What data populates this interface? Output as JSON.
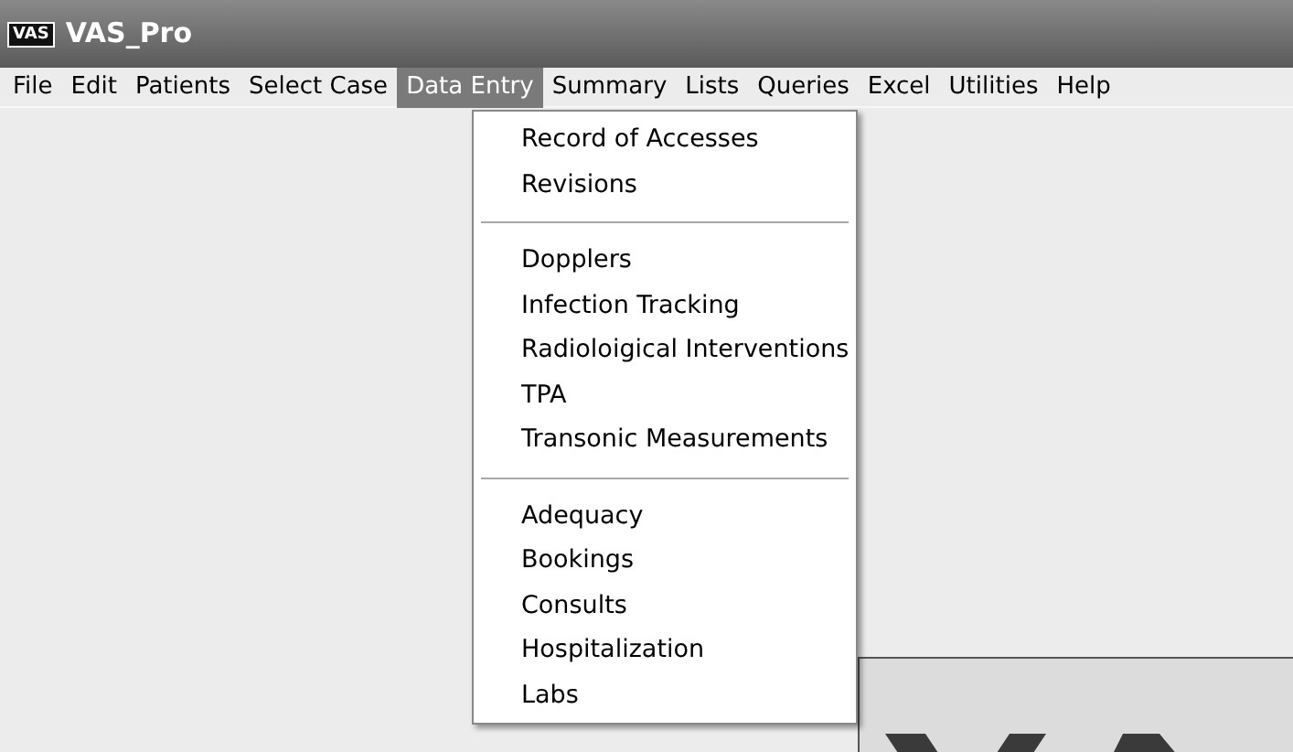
{
  "window": {
    "title": "VAS_Pro",
    "icon_text": "VAS"
  },
  "menu_bar": [
    {
      "label": "File",
      "selected": false
    },
    {
      "label": "Edit",
      "selected": false
    },
    {
      "label": "Patients",
      "selected": false
    },
    {
      "label": "Select Case",
      "selected": false
    },
    {
      "label": "Data Entry",
      "selected": true
    },
    {
      "label": "Summary",
      "selected": false
    },
    {
      "label": "Lists",
      "selected": false
    },
    {
      "label": "Queries",
      "selected": false
    },
    {
      "label": "Excel",
      "selected": false
    },
    {
      "label": "Utilities",
      "selected": false
    },
    {
      "label": "Help",
      "selected": false
    }
  ],
  "dropdown": {
    "groups": [
      [
        "Record of Accesses",
        "Revisions"
      ],
      [
        "Dopplers",
        "Infection Tracking",
        "Radioloigical Interventions",
        "TPA",
        "Transonic Measurements"
      ],
      [
        "Adequacy",
        "Bookings",
        "Consults",
        "Hospitalization",
        "Labs"
      ]
    ]
  }
}
